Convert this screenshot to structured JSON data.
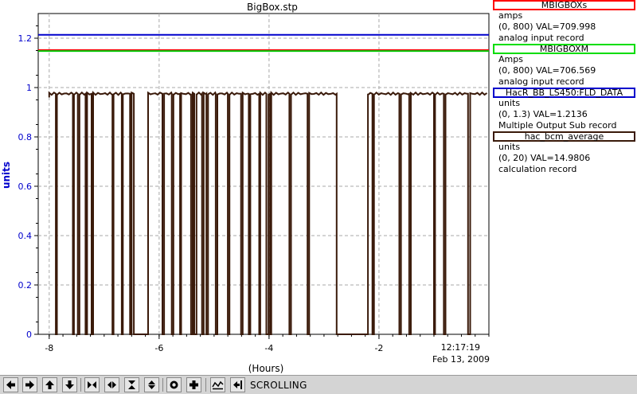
{
  "chart_data": {
    "type": "line",
    "title": "BigBox.stp",
    "xlabel": "(Hours)",
    "ylabel": "units",
    "xlim": [
      -8.2,
      0
    ],
    "ylim": [
      0,
      1.3
    ],
    "x_ticks": [
      -8,
      -6,
      -4,
      -2
    ],
    "x_tick_labels": [
      "-8",
      "-6",
      "-4",
      "-2"
    ],
    "y_ticks": [
      0,
      0.2,
      0.4,
      0.6,
      0.8,
      1.0,
      1.2
    ],
    "y_tick_labels": [
      "0",
      "0.2",
      "0.4",
      "0.6",
      "0.8",
      "1",
      "1.2"
    ],
    "grid": true,
    "time_label": "12:17:19",
    "date_label": "Feb 13, 2009",
    "series": [
      {
        "name": "MBIGBOXs",
        "color": "#ff0000",
        "values": [
          1.152
        ]
      },
      {
        "name": "MBIGBOXM",
        "color": "#00cc00",
        "values": [
          1.148
        ]
      },
      {
        "name": "HacR_BB_LS450:FLD_DATA",
        "color": "#0000cc",
        "values": [
          1.2136
        ]
      },
      {
        "name": "hac_bcm_average",
        "color": "#3a1a0a",
        "baseline": 0.975,
        "dropouts": [
          [
            -7.88,
            -7.86
          ],
          [
            -7.57,
            -7.55
          ],
          [
            -7.48,
            -7.45
          ],
          [
            -7.34,
            -7.31
          ],
          [
            -7.23,
            -7.2
          ],
          [
            -6.85,
            -6.83
          ],
          [
            -6.68,
            -6.66
          ],
          [
            -6.53,
            -6.5
          ],
          [
            -6.46,
            -6.2
          ],
          [
            -5.94,
            -5.91
          ],
          [
            -5.77,
            -5.74
          ],
          [
            -5.62,
            -5.6
          ],
          [
            -5.42,
            -5.39
          ],
          [
            -5.36,
            -5.32
          ],
          [
            -5.22,
            -5.19
          ],
          [
            -5.14,
            -5.11
          ],
          [
            -4.97,
            -4.94
          ],
          [
            -4.75,
            -4.72
          ],
          [
            -4.51,
            -4.48
          ],
          [
            -4.37,
            -4.34
          ],
          [
            -4.18,
            -4.16
          ],
          [
            -4.05,
            -4.01
          ],
          [
            -3.98,
            -3.96
          ],
          [
            -3.63,
            -3.6
          ],
          [
            -3.3,
            -3.27
          ],
          [
            -2.77,
            -2.2
          ],
          [
            -2.12,
            -2.09
          ],
          [
            -1.63,
            -1.6
          ],
          [
            -1.45,
            -1.42
          ],
          [
            -1.0,
            -0.98
          ],
          [
            -0.82,
            -0.79
          ],
          [
            -0.38,
            -0.34
          ]
        ]
      }
    ]
  },
  "legend": [
    {
      "name": "MBIGBOXs",
      "color": "#ff0000",
      "units": "amps",
      "range": "(0, 800)  VAL=709.998",
      "record": "analog input record"
    },
    {
      "name": "MBIGBOXM",
      "color": "#00dd00",
      "units": "Amps",
      "range": "(0, 800)  VAL=706.569",
      "record": "analog input record"
    },
    {
      "name": "HacR_BB_LS450:FLD_DATA",
      "color": "#0000cc",
      "units": "units",
      "range": "(0, 1.3)  VAL=1.2136",
      "record": "Multiple Output Sub record"
    },
    {
      "name": "hac_bcm_average",
      "color": "#3a1a0a",
      "units": "units",
      "range": "(0, 20)  VAL=14.9806",
      "record": "calculation record"
    }
  ],
  "toolbar": {
    "status": "SCROLLING",
    "buttons": [
      "scroll-left",
      "scroll-right",
      "scroll-up",
      "scroll-down",
      "zoom-in-x",
      "zoom-out-x",
      "zoom-in-y",
      "zoom-out-y",
      "auto-scale",
      "add",
      "scroll-mode",
      "hold"
    ]
  }
}
